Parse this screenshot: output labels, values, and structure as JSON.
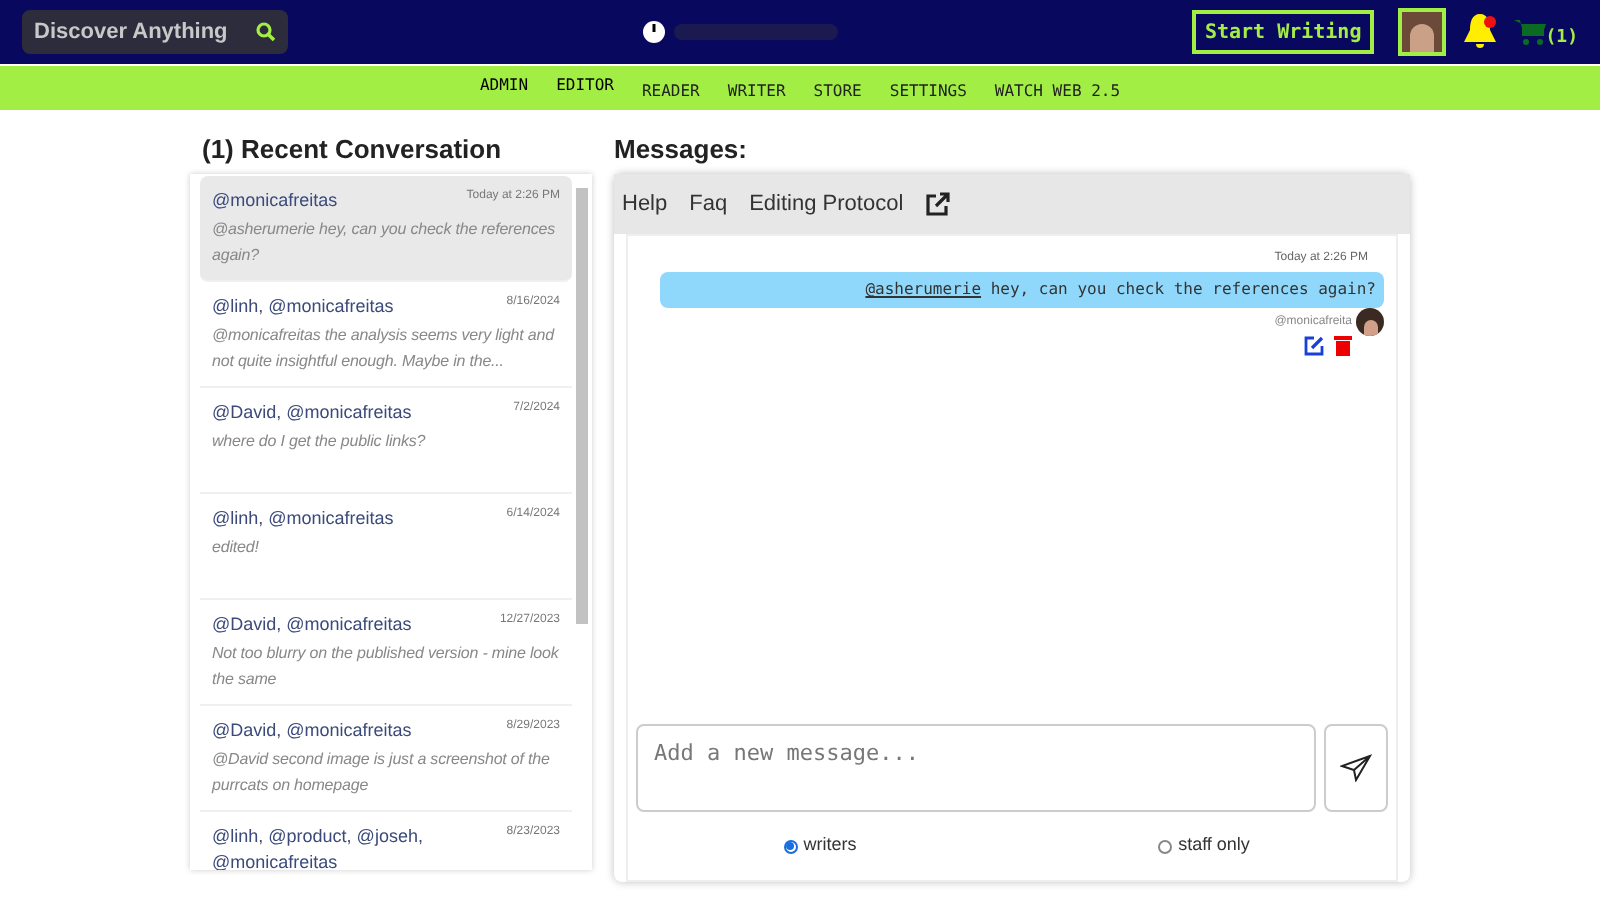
{
  "header": {
    "search": {
      "placeholder": "Discover Anything"
    },
    "start_button": "Start Writing",
    "cart_count": "(1)",
    "notification": true
  },
  "nav": [
    {
      "label": "ADMIN",
      "selected": true
    },
    {
      "label": "EDITOR",
      "selected": true
    },
    {
      "label": "READER",
      "selected": false
    },
    {
      "label": "WRITER",
      "selected": false
    },
    {
      "label": "STORE",
      "selected": false
    },
    {
      "label": "SETTINGS",
      "selected": false
    },
    {
      "label": "WATCH WEB 2.5",
      "selected": false
    }
  ],
  "conversations": {
    "title": "(1) Recent Conversation",
    "items": [
      {
        "participants": "@monicafreitas",
        "date": "Today at 2:26 PM",
        "preview": "@asherumerie hey, can you check the references again?",
        "selected": true
      },
      {
        "participants": "@linh, @monicafreitas",
        "date": "8/16/2024",
        "preview": "@monicafreitas the analysis seems very light and not quite insightful enough. Maybe in the...",
        "selected": false
      },
      {
        "participants": "@David, @monicafreitas",
        "date": "7/2/2024",
        "preview": "where do I get the public links?",
        "selected": false
      },
      {
        "participants": "@linh, @monicafreitas",
        "date": "6/14/2024",
        "preview": "edited!",
        "selected": false
      },
      {
        "participants": "@David, @monicafreitas",
        "date": "12/27/2023",
        "preview": "Not too blurry on the published version - mine look the same",
        "selected": false
      },
      {
        "participants": "@David, @monicafreitas",
        "date": "8/29/2023",
        "preview": "@David second image is just a screenshot of the purrcats on homepage",
        "selected": false
      },
      {
        "participants": "@linh, @product, @joseh, @monicafreitas",
        "date": "8/23/2023",
        "selected": false
      }
    ]
  },
  "messages": {
    "title": "Messages:",
    "links": [
      "Help",
      "Faq",
      "Editing Protocol"
    ],
    "items": [
      {
        "time": "Today at 2:26 PM",
        "mention": "@asherumerie",
        "text": "hey, can you check the references again?",
        "sender": "@monicafreita"
      }
    ],
    "composer": {
      "placeholder": "Add a new message..."
    },
    "audience": [
      {
        "label": "writers",
        "selected": true
      },
      {
        "label": "staff only",
        "selected": false
      }
    ]
  }
}
